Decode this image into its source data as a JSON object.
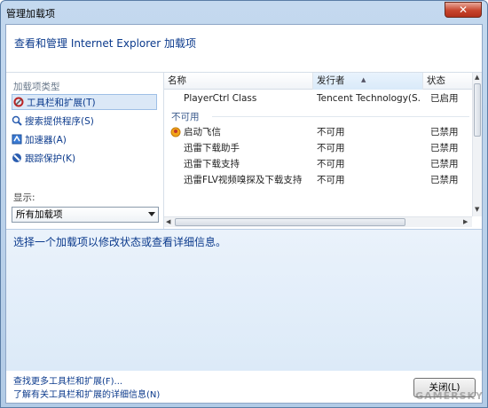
{
  "window": {
    "title": "管理加载项",
    "close_glyph": "✕"
  },
  "header": {
    "title": "查看和管理 Internet Explorer 加载项"
  },
  "sidebar": {
    "heading": "加载项类型",
    "items": [
      {
        "label": "工具栏和扩展(T)",
        "icon": "toolbar-gear-icon",
        "selected": true
      },
      {
        "label": "搜索提供程序(S)",
        "icon": "search-icon",
        "selected": false
      },
      {
        "label": "加速器(A)",
        "icon": "accelerator-icon",
        "selected": false
      },
      {
        "label": "跟踪保护(K)",
        "icon": "tracking-protection-icon",
        "selected": false
      }
    ],
    "show_label": "显示:",
    "show_value": "所有加载项"
  },
  "list": {
    "columns": [
      "名称",
      "发行者",
      "状态"
    ],
    "rows": [
      {
        "name": "PlayerCtrl Class",
        "publisher": "Tencent Technology(S...",
        "status": "已启用",
        "icon": ""
      },
      {
        "group": "不可用"
      },
      {
        "name": "启动飞信",
        "publisher": "不可用",
        "status": "已禁用",
        "icon": "fetion-icon"
      },
      {
        "name": "迅雷下载助手",
        "publisher": "不可用",
        "status": "已禁用",
        "icon": ""
      },
      {
        "name": "迅雷下载支持",
        "publisher": "不可用",
        "status": "已禁用",
        "icon": ""
      },
      {
        "name": "迅雷FLV视频嗅探及下载支持",
        "publisher": "不可用",
        "status": "已禁用",
        "icon": ""
      }
    ]
  },
  "details": {
    "text": "选择一个加载项以修改状态或查看详细信息。"
  },
  "footer": {
    "link1": "查找更多工具栏和扩展(F)...",
    "link2": "了解有关工具栏和扩展的详细信息(N)",
    "close_label": "关闭(L)"
  },
  "watermark": "GAMERSKY",
  "colors": {
    "link": "#0b3a8c",
    "details_bg": "#dceaf8",
    "title_close": "#c7452d"
  }
}
